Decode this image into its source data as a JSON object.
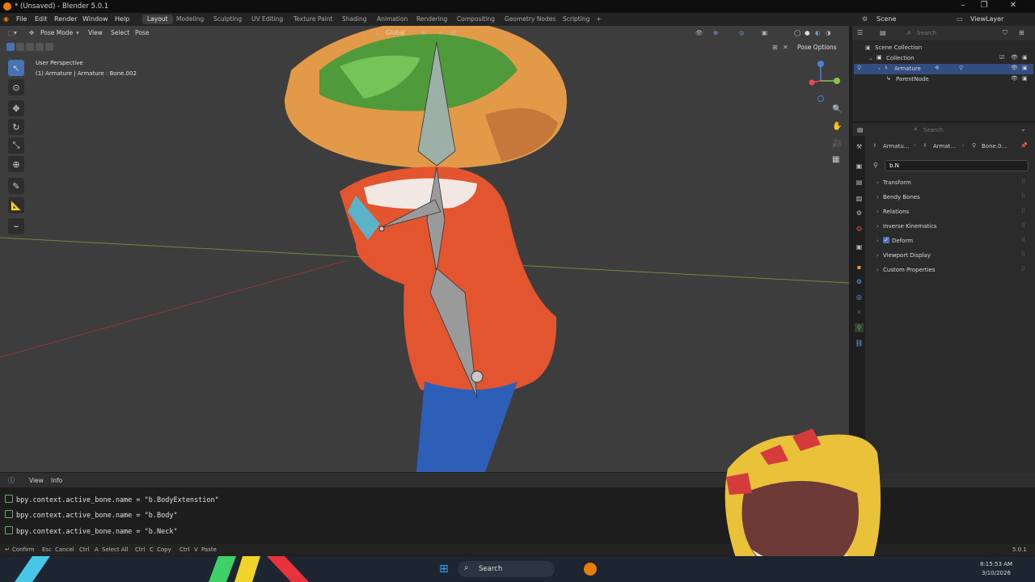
{
  "window": {
    "title": "* (Unsaved) - Blender 5.0.1",
    "controls": [
      "–",
      "❐",
      "✕"
    ]
  },
  "menu": [
    "File",
    "Edit",
    "Render",
    "Window",
    "Help"
  ],
  "workspaces": [
    "Layout",
    "Modeling",
    "Sculpting",
    "UV Editing",
    "Texture Paint",
    "Shading",
    "Animation",
    "Rendering",
    "Compositing",
    "Geometry Nodes",
    "Scripting"
  ],
  "active_workspace": "Layout",
  "scene": {
    "label": "Scene",
    "view_layer": "ViewLayer"
  },
  "viewport": {
    "mode": "Pose Mode",
    "menus": [
      "View",
      "Select",
      "Pose"
    ],
    "transform_orientation": "Global",
    "info_line1": "User Perspective",
    "info_line2": "(1) Armature | Armature : Bone.002",
    "pose_options": "Pose Options"
  },
  "outliner": {
    "search_placeholder": "Search",
    "rows": [
      {
        "label": "Scene Collection"
      },
      {
        "label": "Collection"
      },
      {
        "label": "Armature"
      },
      {
        "label": "ParentNode"
      }
    ]
  },
  "properties": {
    "search_placeholder": "Search",
    "breadcrumb": [
      "Armatu...",
      "Armat...",
      "Bone.0..."
    ],
    "bone_name_value": "b.N",
    "panels": [
      "Transform",
      "Bendy Bones",
      "Relations",
      "Inverse Kinematics",
      "Deform",
      "Viewport Display",
      "Custom Properties"
    ]
  },
  "info_editor": {
    "menus": [
      "View",
      "Info"
    ],
    "log": [
      "bpy.context.active_bone.name = \"b.BodyExtenstion\"",
      "bpy.context.active_bone.name = \"b.Body\"",
      "bpy.context.active_bone.name = \"b.Neck\""
    ]
  },
  "statusbar": {
    "hints": [
      {
        "key": "↵",
        "label": "Confirm"
      },
      {
        "key": "Esc",
        "label": "Cancel"
      },
      {
        "key": "Ctrl",
        "key2": "A",
        "label": "Select All"
      },
      {
        "key": "Ctrl",
        "key2": "C",
        "label": "Copy"
      },
      {
        "key": "Ctrl",
        "key2": "V",
        "label": "Paste"
      }
    ],
    "version": "5.0.1"
  },
  "taskbar": {
    "search": "Search",
    "time": "8:15:53 AM",
    "date": "3/10/2026"
  }
}
